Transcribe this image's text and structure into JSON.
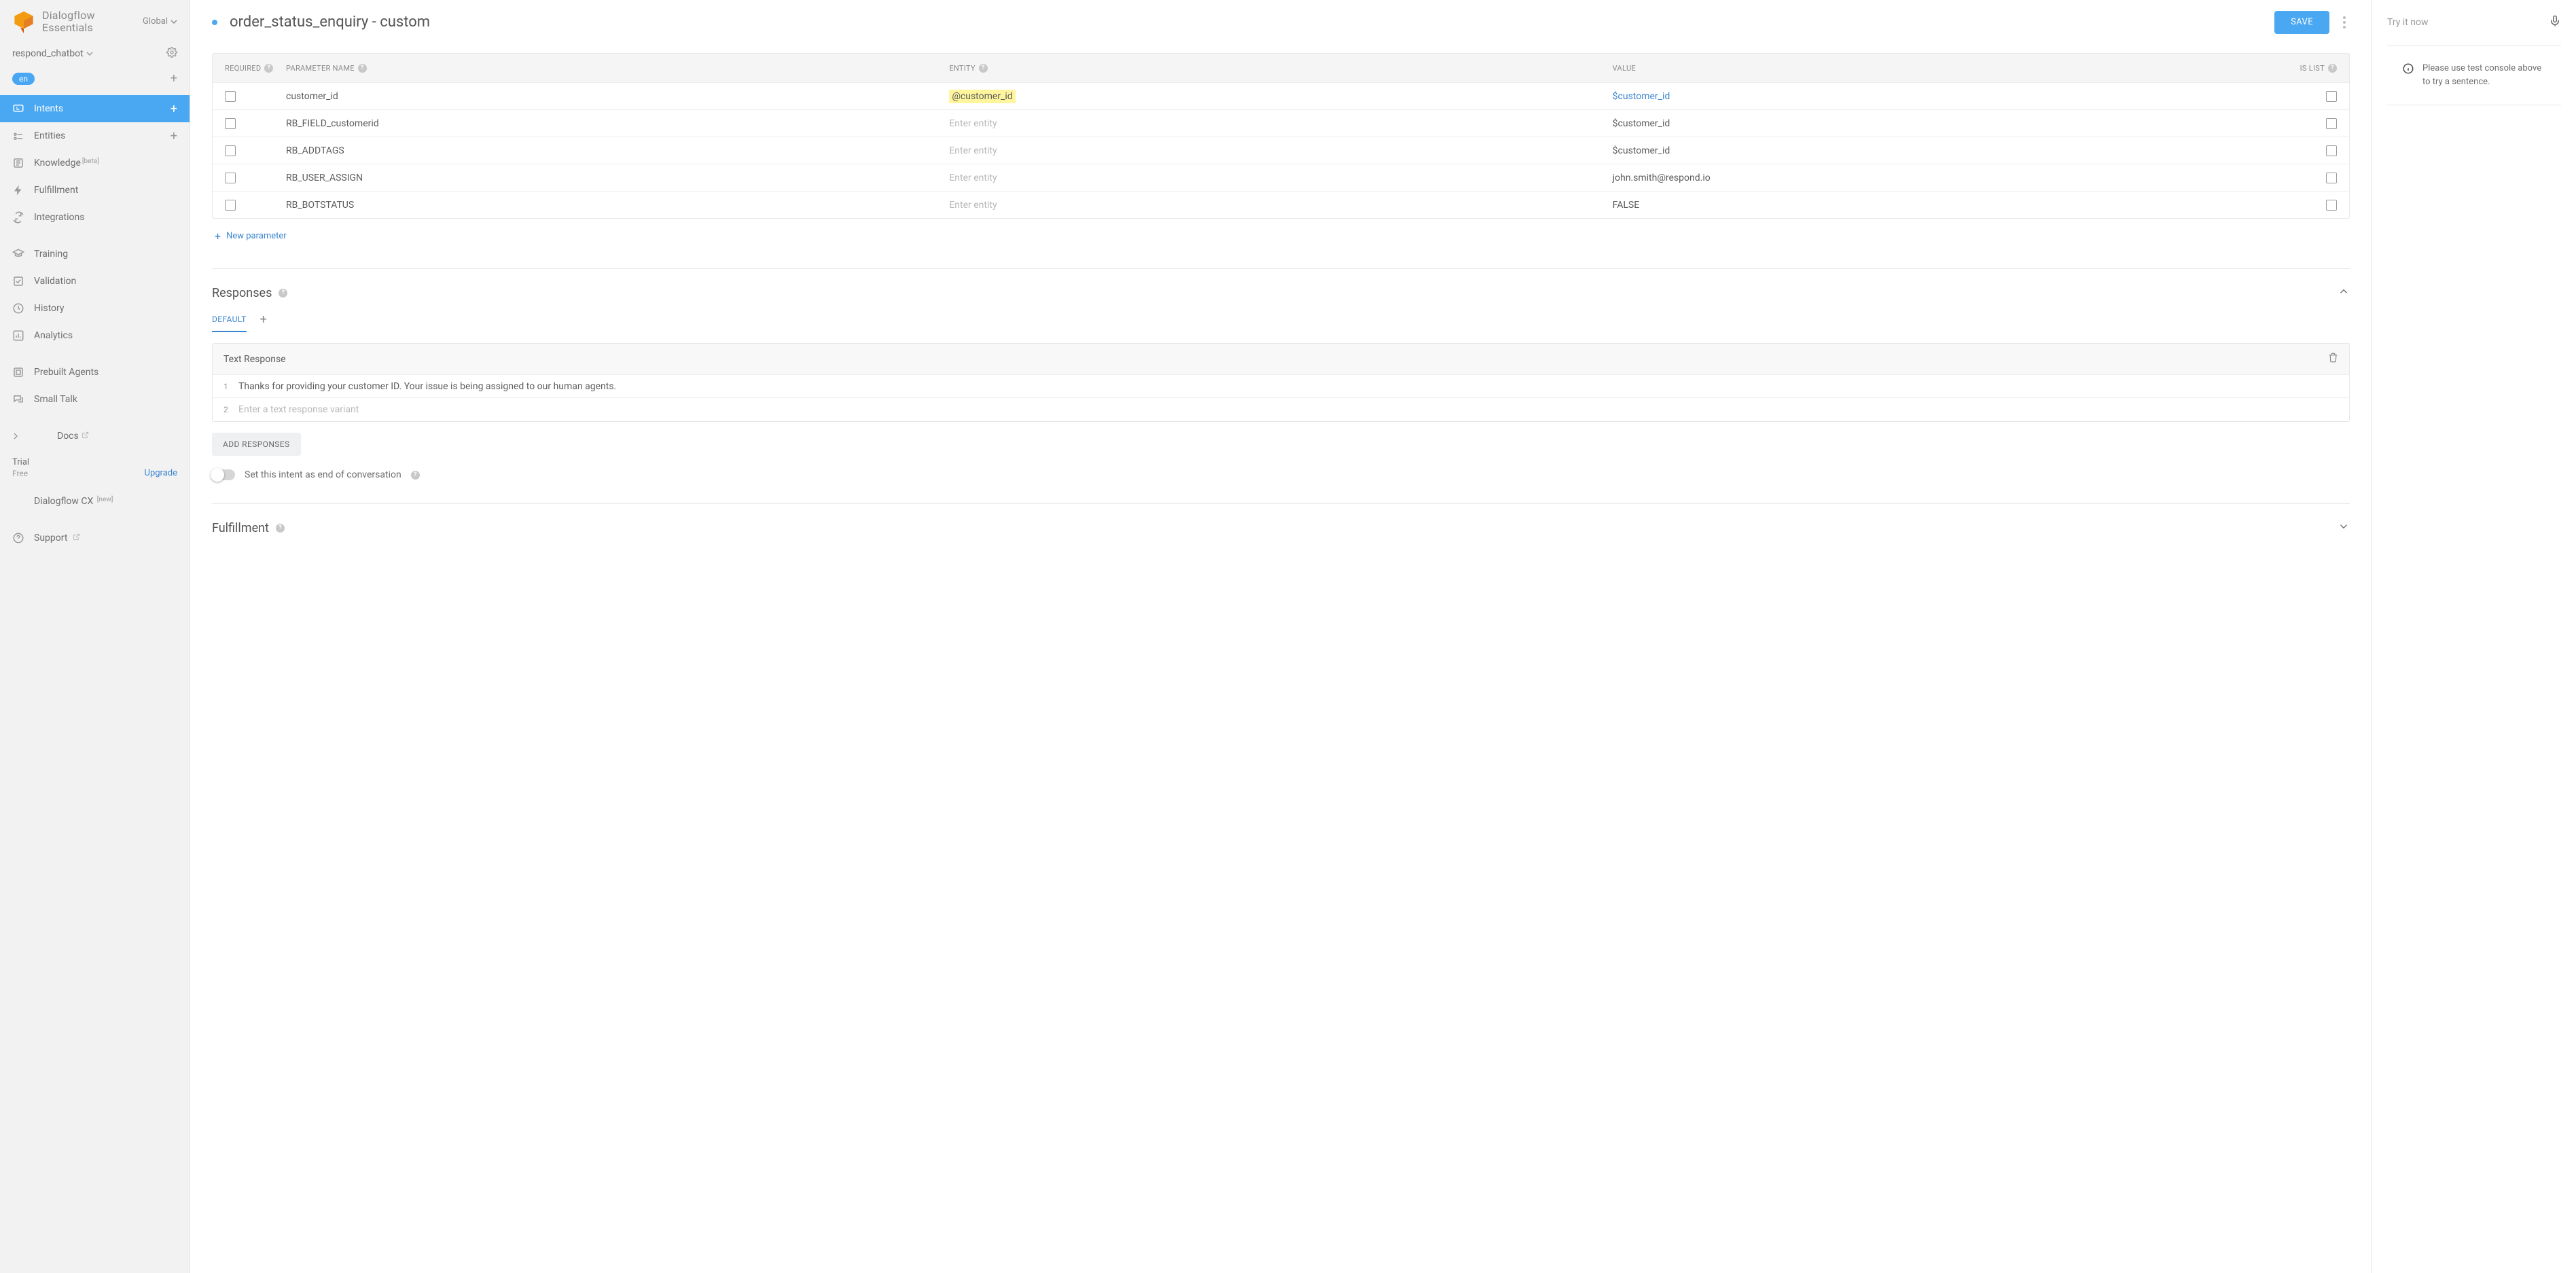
{
  "brand": {
    "line1": "Dialogflow",
    "line2": "Essentials",
    "region": "Global"
  },
  "agent": {
    "name": "respond_chatbot",
    "language": "en"
  },
  "nav": [
    {
      "id": "intents",
      "label": "Intents",
      "icon": "intents",
      "active": true,
      "plus": true
    },
    {
      "id": "entities",
      "label": "Entities",
      "icon": "entities",
      "plus": true
    },
    {
      "id": "knowledge",
      "label": "Knowledge",
      "icon": "knowledge",
      "sup": "[beta]"
    },
    {
      "id": "fulfillment",
      "label": "Fulfillment",
      "icon": "fulfillment"
    },
    {
      "id": "integrations",
      "label": "Integrations",
      "icon": "integrations"
    },
    {
      "sep": true
    },
    {
      "id": "training",
      "label": "Training",
      "icon": "training"
    },
    {
      "id": "validation",
      "label": "Validation",
      "icon": "validation"
    },
    {
      "id": "history",
      "label": "History",
      "icon": "history"
    },
    {
      "id": "analytics",
      "label": "Analytics",
      "icon": "analytics"
    },
    {
      "sep": true
    },
    {
      "id": "prebuilt",
      "label": "Prebuilt Agents",
      "icon": "prebuilt"
    },
    {
      "id": "smalltalk",
      "label": "Small Talk",
      "icon": "smalltalk"
    },
    {
      "sep": true
    },
    {
      "id": "docs",
      "label": "Docs",
      "icon": "docs",
      "ext": true,
      "chevron": true
    }
  ],
  "plan": {
    "label": "Trial",
    "value": "Free",
    "upgrade": "Upgrade"
  },
  "cx": {
    "label": "Dialogflow CX",
    "sup": "[new]"
  },
  "support": {
    "label": "Support",
    "ext": true
  },
  "header": {
    "title": "order_status_enquiry - custom",
    "save": "SAVE"
  },
  "params": {
    "columns": {
      "required": "REQUIRED",
      "name": "PARAMETER NAME",
      "entity": "ENTITY",
      "value": "VALUE",
      "islist": "IS LIST"
    },
    "entity_placeholder": "Enter entity",
    "rows": [
      {
        "name": "customer_id",
        "entity": "@customer_id",
        "entity_highlight": true,
        "value": "$customer_id",
        "value_link": true
      },
      {
        "name": "RB_FIELD_customerid",
        "entity": "",
        "value": "$customer_id"
      },
      {
        "name": "RB_ADDTAGS",
        "entity": "",
        "value": "$customer_id"
      },
      {
        "name": "RB_USER_ASSIGN",
        "entity": "",
        "value": "john.smith@respond.io"
      },
      {
        "name": "RB_BOTSTATUS",
        "entity": "",
        "value": "FALSE"
      }
    ],
    "new_param": "New parameter"
  },
  "responses": {
    "title": "Responses",
    "tab_default": "DEFAULT",
    "box_title": "Text Response",
    "lines": [
      "Thanks for providing your customer ID. Your issue is being assigned to our human agents."
    ],
    "variant_placeholder": "Enter a text response variant",
    "add_button": "ADD RESPONSES",
    "eoc_label": "Set this intent as end of conversation"
  },
  "fulfillment": {
    "title": "Fulfillment"
  },
  "test": {
    "placeholder": "Try it now",
    "hint": "Please use test console above to try a sentence."
  }
}
